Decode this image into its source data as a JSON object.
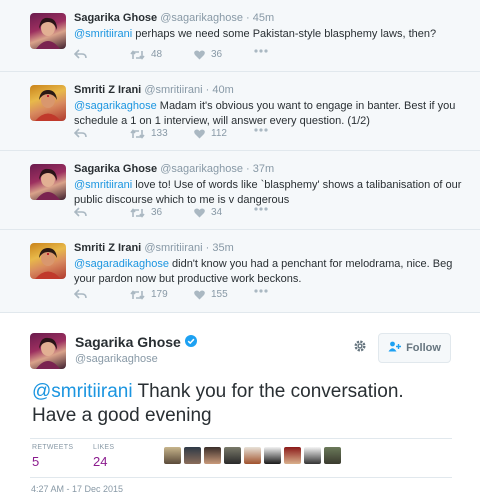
{
  "thread": [
    {
      "name": "Sagarika Ghose",
      "handle": "@sagarikaghose",
      "time": "· 45m",
      "mention": "@smritiirani",
      "text": " perhaps we need some Pakistan-style blasphemy laws, then?",
      "retweets": "48",
      "likes": "36",
      "avatar_icon": "avatar-sagarika"
    },
    {
      "name": "Smriti Z Irani",
      "handle": "@smritiirani",
      "time": "· 40m",
      "mention": "@sagarikaghose",
      "text": " Madam it's obvious you want to engage in banter. Best if you schedule a 1 on 1 interview, will answer every question. (1/2)",
      "retweets": "133",
      "likes": "112",
      "avatar_icon": "avatar-smriti"
    },
    {
      "name": "Sagarika Ghose",
      "handle": "@sagarikaghose",
      "time": "· 37m",
      "mention": "@smritiirani",
      "text": " love to! Use of words like `blasphemy' shows a talibanisation of our public discourse which to me is v dangerous",
      "retweets": "36",
      "likes": "34",
      "avatar_icon": "avatar-sagarika"
    },
    {
      "name": "Smriti Z Irani",
      "handle": "@smritiirani",
      "time": "· 35m",
      "mention": "@sagaradikaghose",
      "text": " didn't know you had a penchant for melodrama, nice. Beg your pardon now but productive work beckons.",
      "retweets": "179",
      "likes": "155",
      "avatar_icon": "avatar-smriti"
    }
  ],
  "main_tweet": {
    "name": "Sagarika Ghose",
    "handle": "@sagarikaghose",
    "verified_icon": "verified-badge-icon",
    "follow_label": "Follow",
    "mention": "@smritiirani",
    "text": " Thank you for the conversation. Have a good evening",
    "retweets_label": "RETWEETS",
    "retweets": "5",
    "likes_label": "LIKES",
    "likes": "24",
    "timestamp": "4:27 AM - 17 Dec 2015"
  },
  "colors": {
    "link": "#1b95e0",
    "stat_number": "#8b1b8e",
    "muted": "#8899a6",
    "thread_bg": "#f5f8fa"
  }
}
